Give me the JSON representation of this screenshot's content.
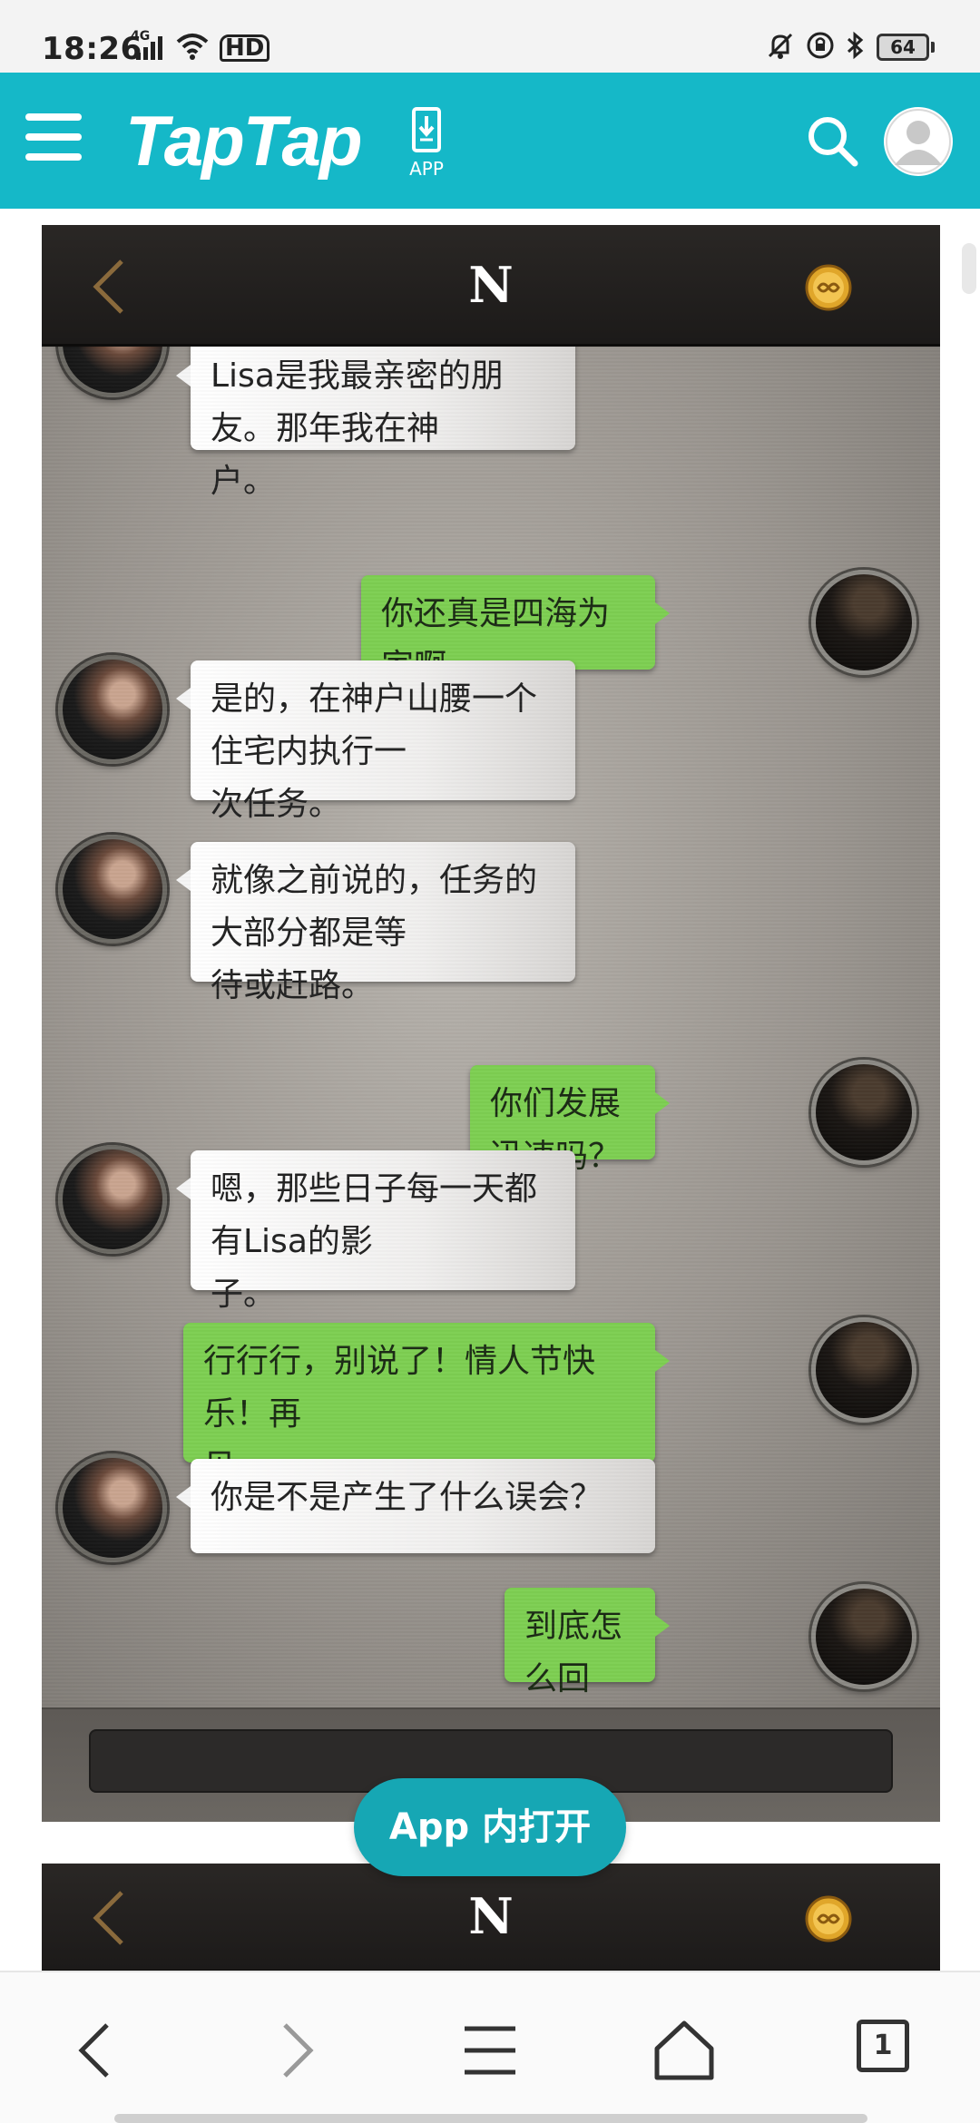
{
  "status_bar": {
    "time": "18:26",
    "network": "4G",
    "hd": "HD",
    "battery": "64"
  },
  "header": {
    "logo": "TapTap",
    "app_download_label": "APP",
    "accent_color": "#15b8c8"
  },
  "game": {
    "title": "N",
    "chat": [
      {
        "side": "left",
        "lines": [
          "Lisa是我最亲密的朋友。那年我在神",
          "户。"
        ]
      },
      {
        "side": "right",
        "lines": [
          "你还真是四海为家啊……"
        ]
      },
      {
        "side": "left",
        "lines": [
          "是的，在神户山腰一个住宅内执行一",
          "次任务。"
        ]
      },
      {
        "side": "left",
        "lines": [
          "就像之前说的，任务的大部分都是等",
          "待或赶路。"
        ]
      },
      {
        "side": "right",
        "lines": [
          "你们发展迅速吗？"
        ]
      },
      {
        "side": "left",
        "lines": [
          "嗯，那些日子每一天都有Lisa的影",
          "子。"
        ]
      },
      {
        "side": "right",
        "lines": [
          "行行行，别说了！情人节快乐！再",
          "见。"
        ]
      },
      {
        "side": "left",
        "lines": [
          "你是不是产生了什么误会？"
        ]
      },
      {
        "side": "right",
        "lines": [
          "到底怎么回事？"
        ]
      }
    ],
    "second_panel_title": "N"
  },
  "open_in_app_label": "App 内打开",
  "browser_nav": {
    "tab_count": "1"
  }
}
